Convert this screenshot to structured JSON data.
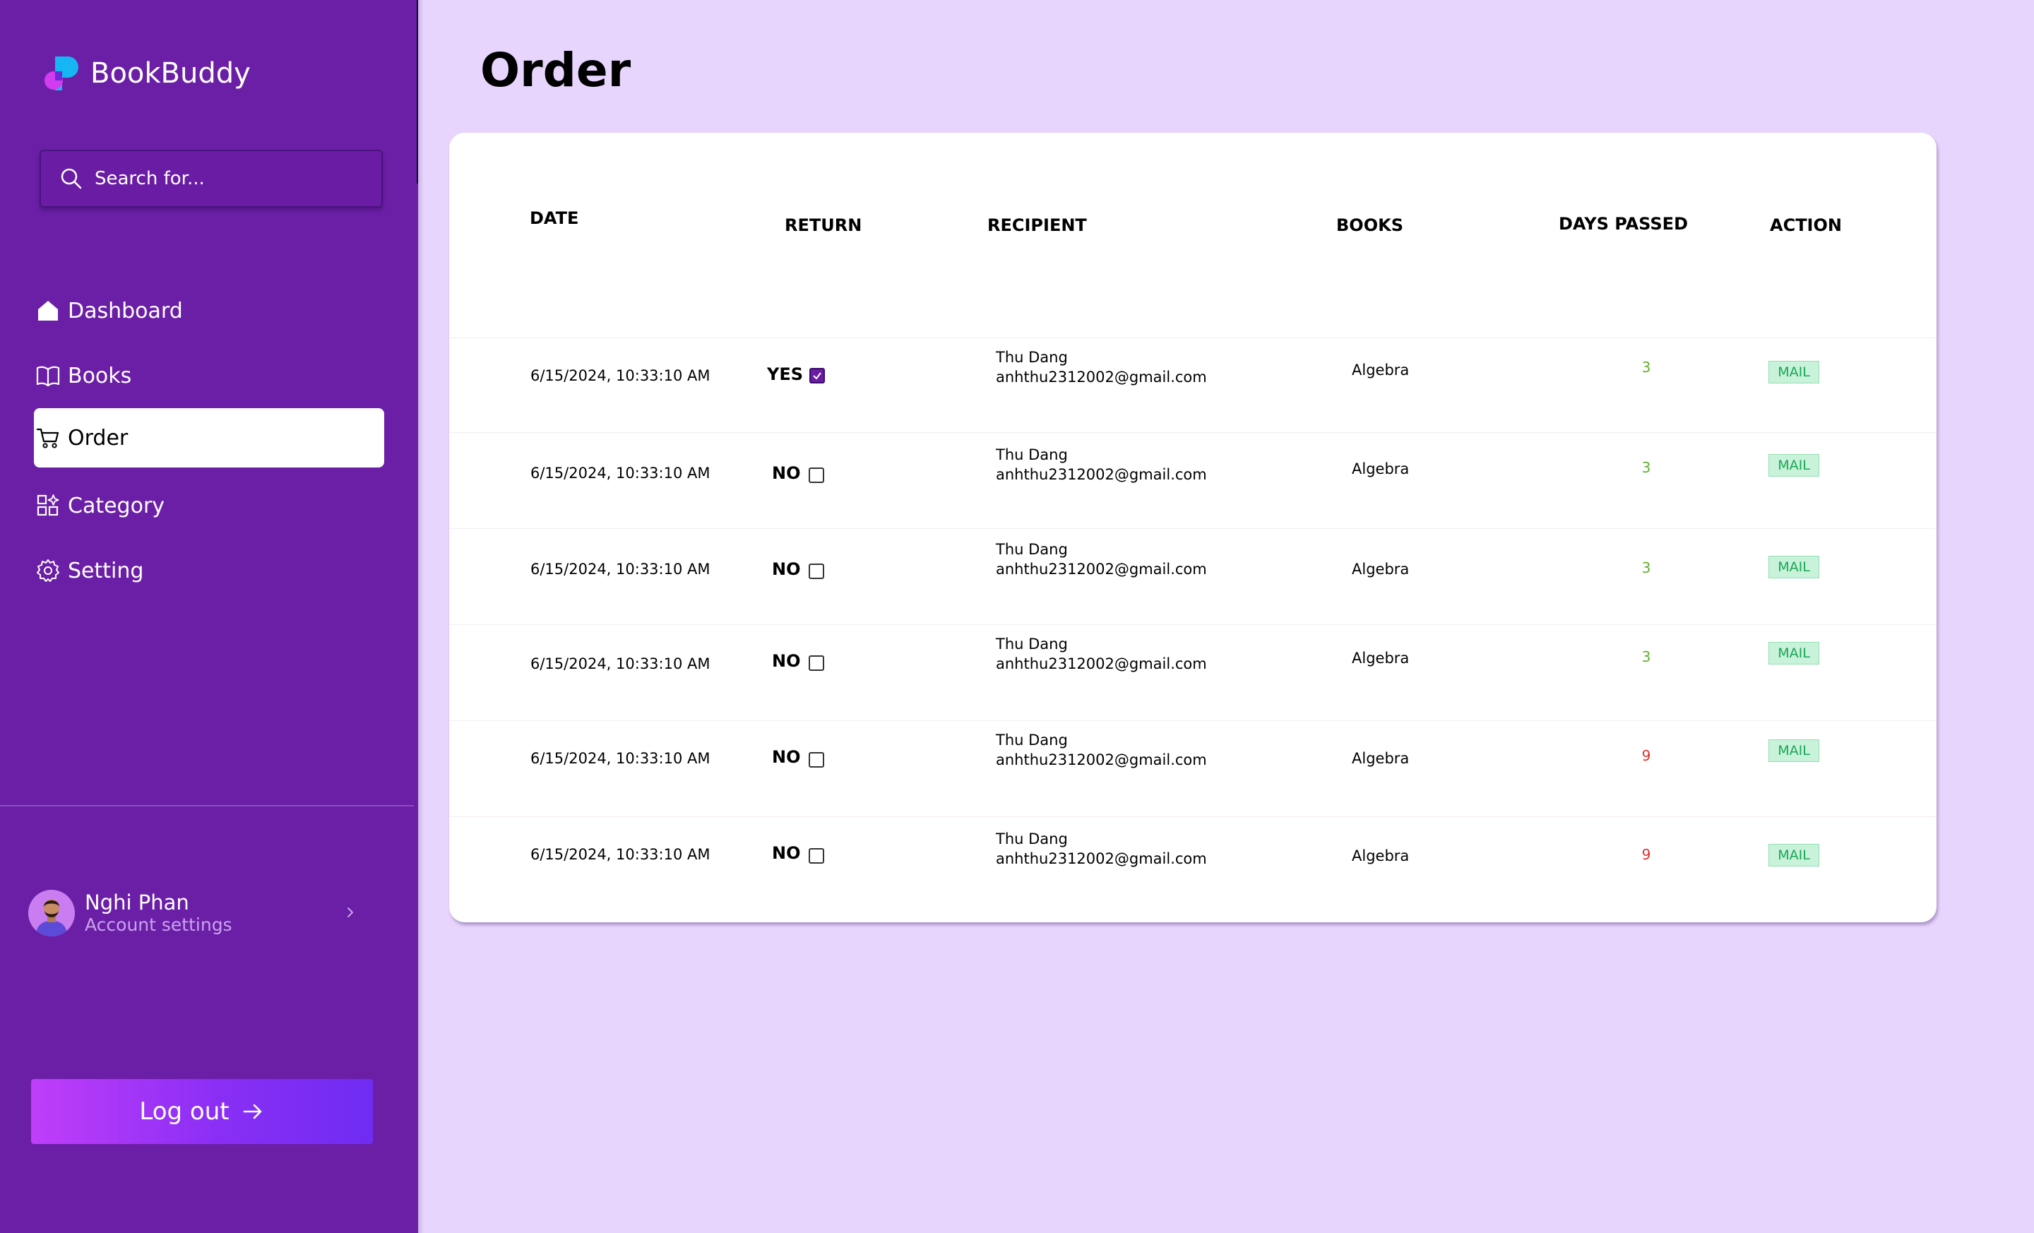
{
  "app": {
    "name": "BookBuddy"
  },
  "search": {
    "placeholder": "Search for..."
  },
  "nav": {
    "items": [
      {
        "label": "Dashboard",
        "icon": "home-icon"
      },
      {
        "label": "Books",
        "icon": "book-icon"
      },
      {
        "label": "Order",
        "icon": "cart-icon",
        "active": true
      },
      {
        "label": "Category",
        "icon": "category-icon"
      },
      {
        "label": "Setting",
        "icon": "gear-icon"
      }
    ]
  },
  "user": {
    "name": "Nghi Phan",
    "subtitle": "Account settings"
  },
  "logout": {
    "label": "Log out"
  },
  "page": {
    "title": "Order"
  },
  "table": {
    "columns": [
      "DATE",
      "RETURN",
      "RECIPIENT",
      "BOOKS",
      "DAYS PASSED",
      "ACTION"
    ],
    "rows": [
      {
        "date": "6/15/2024, 10:33:10 AM",
        "returned": "YES",
        "checked": true,
        "name": "Thu Dang",
        "email": "anhthu2312002@gmail.com",
        "book": "Algebra",
        "days": "3",
        "action": "MAIL"
      },
      {
        "date": "6/15/2024, 10:33:10 AM",
        "returned": "NO",
        "checked": false,
        "name": "Thu Dang",
        "email": "anhthu2312002@gmail.com",
        "book": "Algebra",
        "days": "3",
        "action": "MAIL"
      },
      {
        "date": "6/15/2024, 10:33:10 AM",
        "returned": "NO",
        "checked": false,
        "name": "Thu Dang",
        "email": "anhthu2312002@gmail.com",
        "book": "Algebra",
        "days": "3",
        "action": "MAIL"
      },
      {
        "date": "6/15/2024, 10:33:10 AM",
        "returned": "NO",
        "checked": false,
        "name": "Thu Dang",
        "email": "anhthu2312002@gmail.com",
        "book": "Algebra",
        "days": "3",
        "action": "MAIL"
      },
      {
        "date": "6/15/2024, 10:33:10 AM",
        "returned": "NO",
        "checked": false,
        "name": "Thu Dang",
        "email": "anhthu2312002@gmail.com",
        "book": "Algebra",
        "days": "9",
        "action": "MAIL"
      },
      {
        "date": "6/15/2024, 10:33:10 AM",
        "returned": "NO",
        "checked": false,
        "name": "Thu Dang",
        "email": "anhthu2312002@gmail.com",
        "book": "Algebra",
        "days": "9",
        "action": "MAIL"
      }
    ]
  },
  "colors": {
    "sidebar": "#6b1fa6",
    "background": "#e8d5fd",
    "days_ok": "#5fb32c",
    "days_overdue": "#e0302f",
    "mail_bg": "#c8f2d9",
    "mail_text": "#1aa656"
  }
}
